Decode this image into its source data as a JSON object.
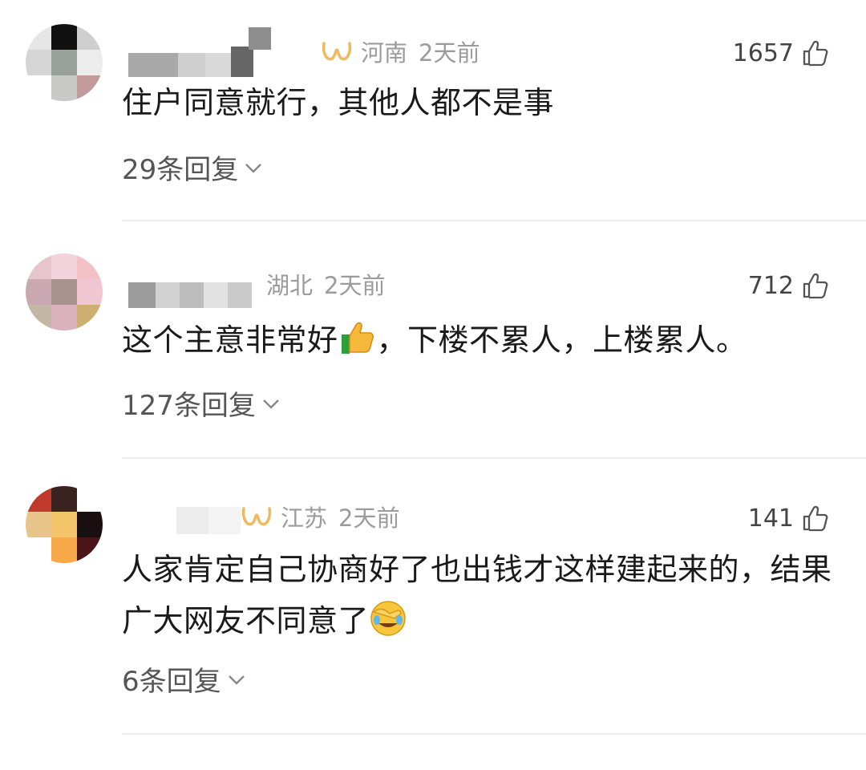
{
  "comments": [
    {
      "region": "河南",
      "time": "2天前",
      "likes": "1657",
      "text": "住户同意就行，其他人都不是事",
      "text_emoji": "",
      "replies": "29条回复",
      "has_badge": true,
      "emoji_name": ""
    },
    {
      "region": "湖北",
      "time": "2天前",
      "likes": "712",
      "text": "这个主意非常好",
      "text_emoji": "，下楼不累人，上楼累人。",
      "replies": "127条回复",
      "has_badge": false,
      "emoji_name": "thumbs-up-emoji"
    },
    {
      "region": "江苏",
      "time": "2天前",
      "likes": "141",
      "text": "人家肯定自己协商好了也出钱才这样建起来的，结果广大网友不同意了",
      "text_emoji": "",
      "replies": "6条回复",
      "has_badge": true,
      "emoji_name": "facepalm-laugh-emoji"
    }
  ],
  "icons": {
    "like": "thumb-up-outline-icon",
    "expand": "chevron-down-icon",
    "badge": "gold-infinity-badge-icon"
  },
  "colors": {
    "badge": "#f0b860",
    "meta_text": "#9b9b9b",
    "divider": "#ececec"
  }
}
